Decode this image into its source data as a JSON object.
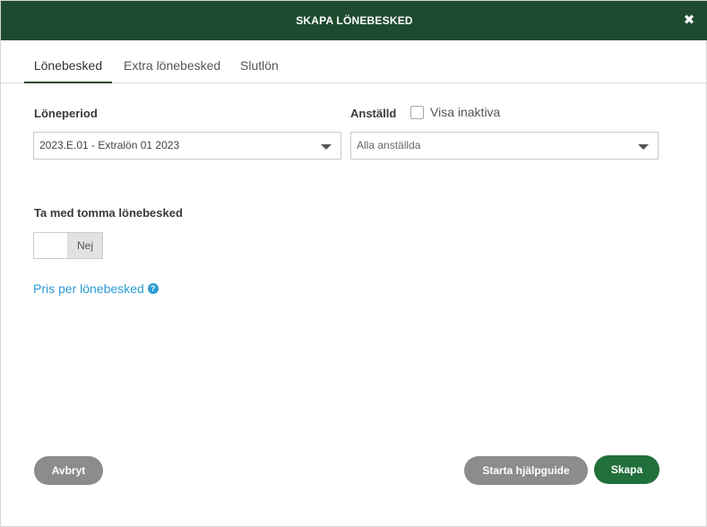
{
  "dialog": {
    "title": "SKAPA LÖNEBESKED",
    "close_glyph": "✖"
  },
  "tabs": [
    {
      "label": "Lönebesked",
      "active": true
    },
    {
      "label": "Extra lönebesked",
      "active": false
    },
    {
      "label": "Slutlön",
      "active": false
    }
  ],
  "form": {
    "period_label": "Löneperiod",
    "period_value": "2023.E.01 - Extralön 01 2023",
    "employee_label": "Anställd",
    "show_inactive_label": "Visa inaktiva",
    "show_inactive_checked": false,
    "employee_value": "Alla anställda",
    "include_empty_label": "Ta med tomma lönebesked",
    "include_empty_value": "Nej",
    "price_link": "Pris per lönebesked",
    "help_glyph": "?"
  },
  "footer": {
    "cancel_label": "Avbryt",
    "guide_label": "Starta hjälpguide",
    "create_label": "Skapa"
  },
  "colors": {
    "header_bg": "#1e4b2f",
    "primary_button": "#21703b",
    "secondary_button": "#8c8c8c",
    "link": "#2a9bd4"
  },
  "icons": [
    "close-icon",
    "chevron-down-icon",
    "help-icon",
    "checkbox"
  ]
}
